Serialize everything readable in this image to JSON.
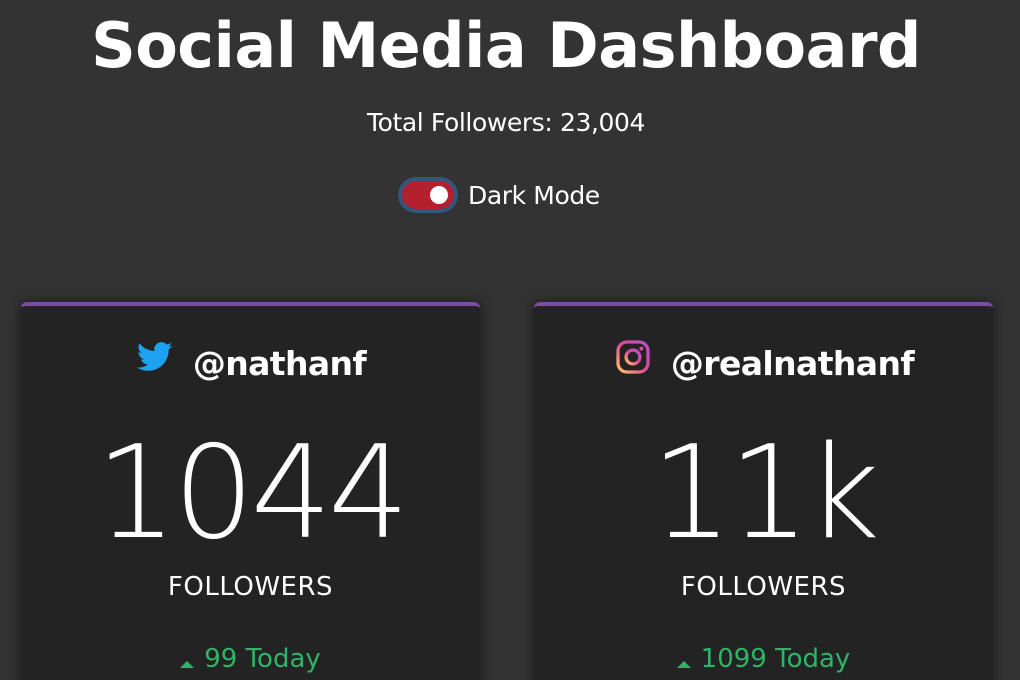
{
  "header": {
    "title": "Social Media Dashboard",
    "total_followers": "Total Followers: 23,004"
  },
  "toggle": {
    "label": "Dark Mode",
    "on": true
  },
  "cards": [
    {
      "platform": "twitter",
      "icon": "twitter-bird-icon",
      "handle": "@nathanf",
      "count": "1044",
      "label": "FOLLOWERS",
      "today": "99 Today"
    },
    {
      "platform": "instagram",
      "icon": "instagram-icon",
      "handle": "@realnathanf",
      "count": "11k",
      "label": "FOLLOWERS",
      "today": "1099 Today"
    }
  ],
  "colors": {
    "background": "#333333",
    "card": "#232323",
    "card_top_border": "#7b4ba8",
    "toggle_track": "#b5202e",
    "toggle_ring": "#34567d",
    "positive": "#2fb466",
    "twitter": "#1da1f2"
  }
}
